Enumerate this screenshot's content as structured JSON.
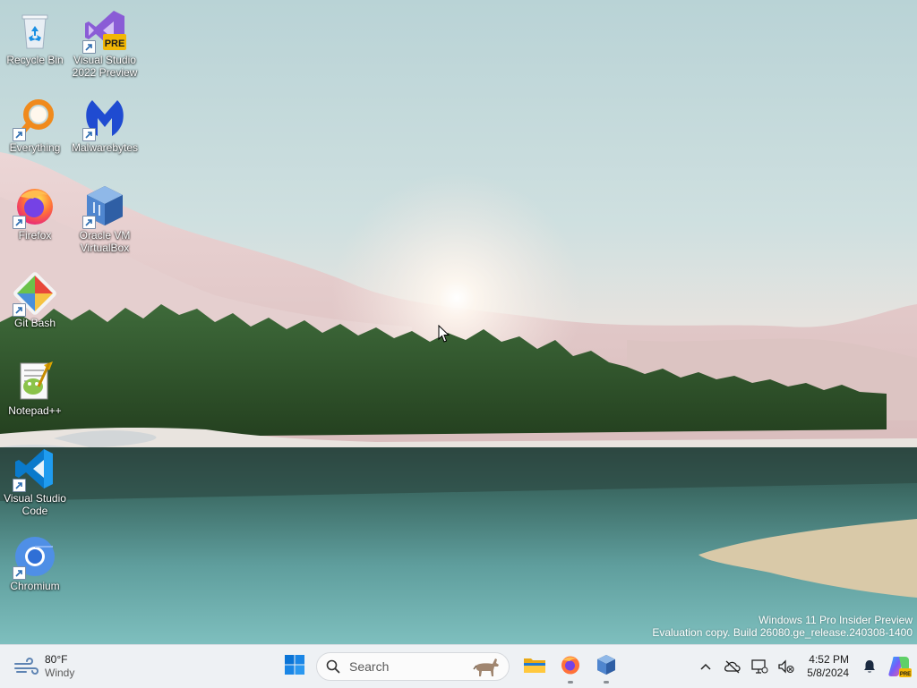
{
  "desktop": {
    "icons": [
      {
        "label": "Recycle Bin",
        "icon": "recycle-bin-icon"
      },
      {
        "label": "Visual Studio 2022 Preview",
        "icon": "visual-studio-preview-icon",
        "badge": "PRE"
      },
      {
        "label": "Everything",
        "icon": "everything-search-icon"
      },
      {
        "label": "Malwarebytes",
        "icon": "malwarebytes-icon"
      },
      {
        "label": "Firefox",
        "icon": "firefox-icon"
      },
      {
        "label": "Oracle VM VirtualBox",
        "icon": "virtualbox-icon"
      },
      {
        "label": "Git Bash",
        "icon": "git-bash-icon"
      },
      {
        "label": "Notepad++",
        "icon": "notepad-plus-plus-icon"
      },
      {
        "label": "Visual Studio Code",
        "icon": "vscode-icon"
      },
      {
        "label": "Chromium",
        "icon": "chromium-icon"
      }
    ]
  },
  "watermark": {
    "line1": "Windows 11 Pro Insider Preview",
    "line2": "Evaluation copy. Build 26080.ge_release.240308-1400"
  },
  "taskbar": {
    "weather": {
      "temp": "80°F",
      "condition": "Windy",
      "icon": "windy-weather-icon"
    },
    "search": {
      "placeholder": "Search"
    },
    "pinned": [
      {
        "name": "start-button",
        "icon": "windows-logo-icon"
      },
      {
        "name": "file-explorer",
        "icon": "folder-icon",
        "running": false
      },
      {
        "name": "firefox",
        "icon": "firefox-icon",
        "running": true
      },
      {
        "name": "virtualbox",
        "icon": "virtualbox-icon",
        "running": true
      }
    ],
    "tray": {
      "icons": [
        "chevron-up-icon",
        "onedrive-offline-icon",
        "network-display-icon",
        "volume-muted-icon",
        "bell-icon",
        "copilot-icon"
      ]
    },
    "clock": {
      "time": "4:52 PM",
      "date": "5/8/2024"
    }
  },
  "colors": {
    "taskbar_bg": "#eef1f4",
    "windows_blue": "#0078d4",
    "label_text": "#ffffff"
  }
}
